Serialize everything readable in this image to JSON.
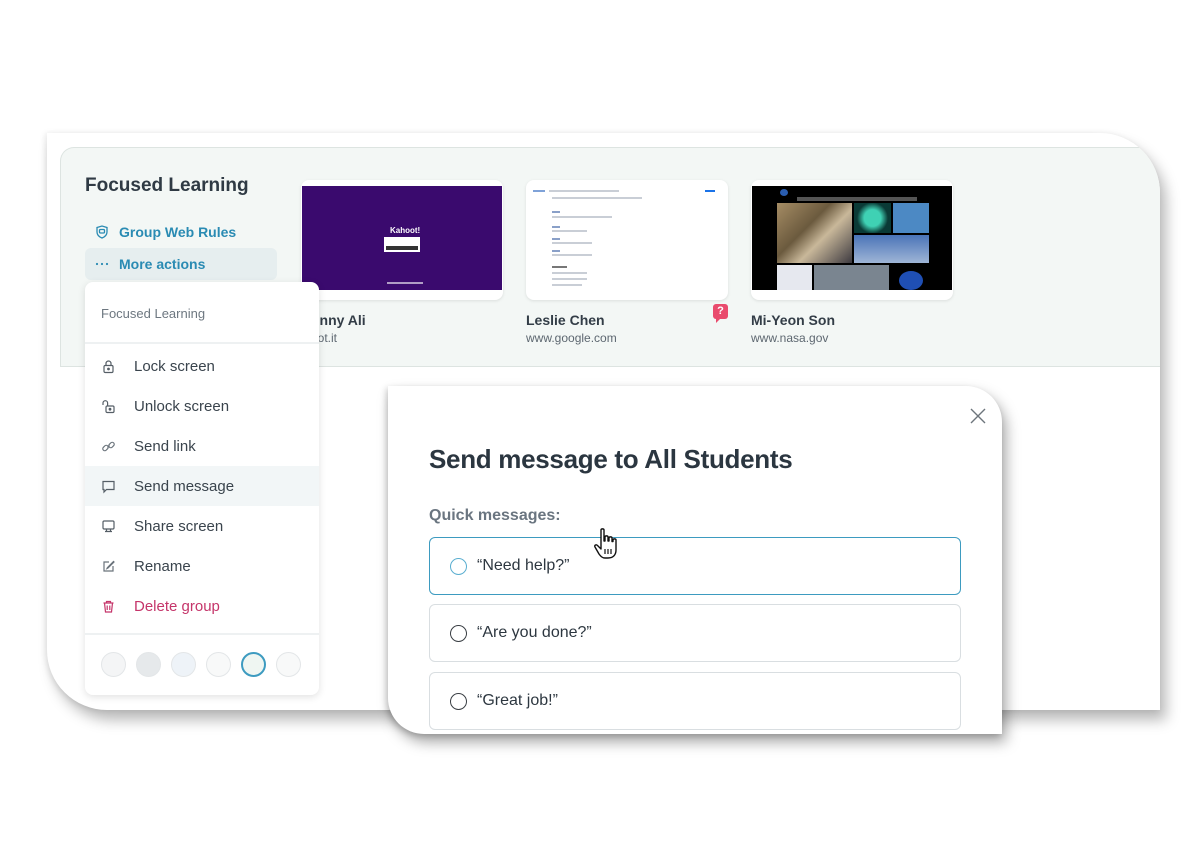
{
  "group": {
    "title": "Focused Learning",
    "actions": [
      {
        "label": "Group Web Rules",
        "icon": "shield-icon"
      },
      {
        "label": "More actions",
        "icon": "ellipsis-icon"
      }
    ]
  },
  "students": [
    {
      "name": "Johnny Ali",
      "name_visible": "hnny Ali",
      "url": "kahoot.it",
      "url_visible": "oot.it",
      "thumbnail": "kahoot-join-screen",
      "logo_text": "Kahoot!"
    },
    {
      "name": "Leslie Chen",
      "url": "www.google.com",
      "thumbnail": "google-search-results",
      "help_badge": "?"
    },
    {
      "name": "Mi-Yeon Son",
      "url": "www.nasa.gov",
      "thumbnail": "nasa-homepage"
    }
  ],
  "menu": {
    "header": "Focused Learning",
    "items": [
      {
        "label": "Lock screen",
        "icon": "lock-icon"
      },
      {
        "label": "Unlock screen",
        "icon": "unlock-icon"
      },
      {
        "label": "Send link",
        "icon": "link-icon"
      },
      {
        "label": "Send message",
        "icon": "message-icon",
        "active": true
      },
      {
        "label": "Share screen",
        "icon": "monitor-icon"
      },
      {
        "label": "Rename",
        "icon": "edit-icon"
      },
      {
        "label": "Delete group",
        "icon": "trash-icon",
        "danger": true
      }
    ],
    "swatches": [
      {
        "color": "#f4f5f6",
        "selected": false
      },
      {
        "color": "#e6e9eb",
        "selected": false
      },
      {
        "color": "#eef3f8",
        "selected": false
      },
      {
        "color": "#f8f9f9",
        "selected": false
      },
      {
        "color": "#eff6f2",
        "selected": true
      },
      {
        "color": "#f8f9f9",
        "selected": false
      }
    ]
  },
  "dialog": {
    "title": "Send message to All Students",
    "quick_label": "Quick messages:",
    "options": [
      "“Need help?”",
      "“Are you done?”",
      "“Great job!”"
    ]
  },
  "colors": {
    "accent": "#2a8bb3",
    "danger": "#c5356a",
    "panel_bg": "#f3f7f5",
    "selected_border": "#3d9bc0"
  }
}
